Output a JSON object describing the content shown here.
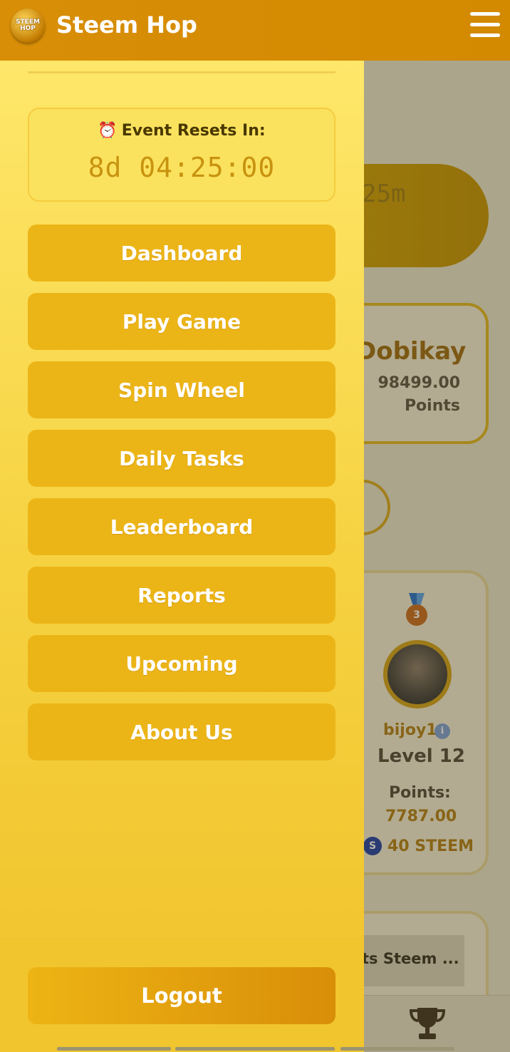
{
  "header": {
    "logo_text": "STEEM HOP",
    "title": "Steem Hop"
  },
  "drawer": {
    "event": {
      "label": "Event Resets In:",
      "timer": "8d 04:25:00"
    },
    "menu": [
      {
        "label": "Dashboard"
      },
      {
        "label": "Play Game"
      },
      {
        "label": "Spin Wheel"
      },
      {
        "label": "Daily Tasks"
      },
      {
        "label": "Leaderboard"
      },
      {
        "label": "Reports"
      },
      {
        "label": "Upcoming"
      },
      {
        "label": "About Us"
      }
    ],
    "logout_label": "Logout"
  },
  "background": {
    "timer_partial": "25m",
    "top_user": {
      "name_partial": "Dobikay",
      "points_value": "98499.00",
      "points_label": "Points"
    },
    "third_place": {
      "medal": "3",
      "username": "bijoy1",
      "info_icon": "i",
      "level": "Level 12",
      "points_label": "Points:",
      "points": "7787.00",
      "steem_icon": "S",
      "reward": "40 STEEM"
    },
    "table_header_partial": "ts   Steem ..."
  },
  "colors": {
    "header": "#d88e07",
    "drawer_top": "#fee76a",
    "drawer_bottom": "#f0c22a",
    "menu_button": "#ecb517",
    "timer": "#c8930f"
  }
}
